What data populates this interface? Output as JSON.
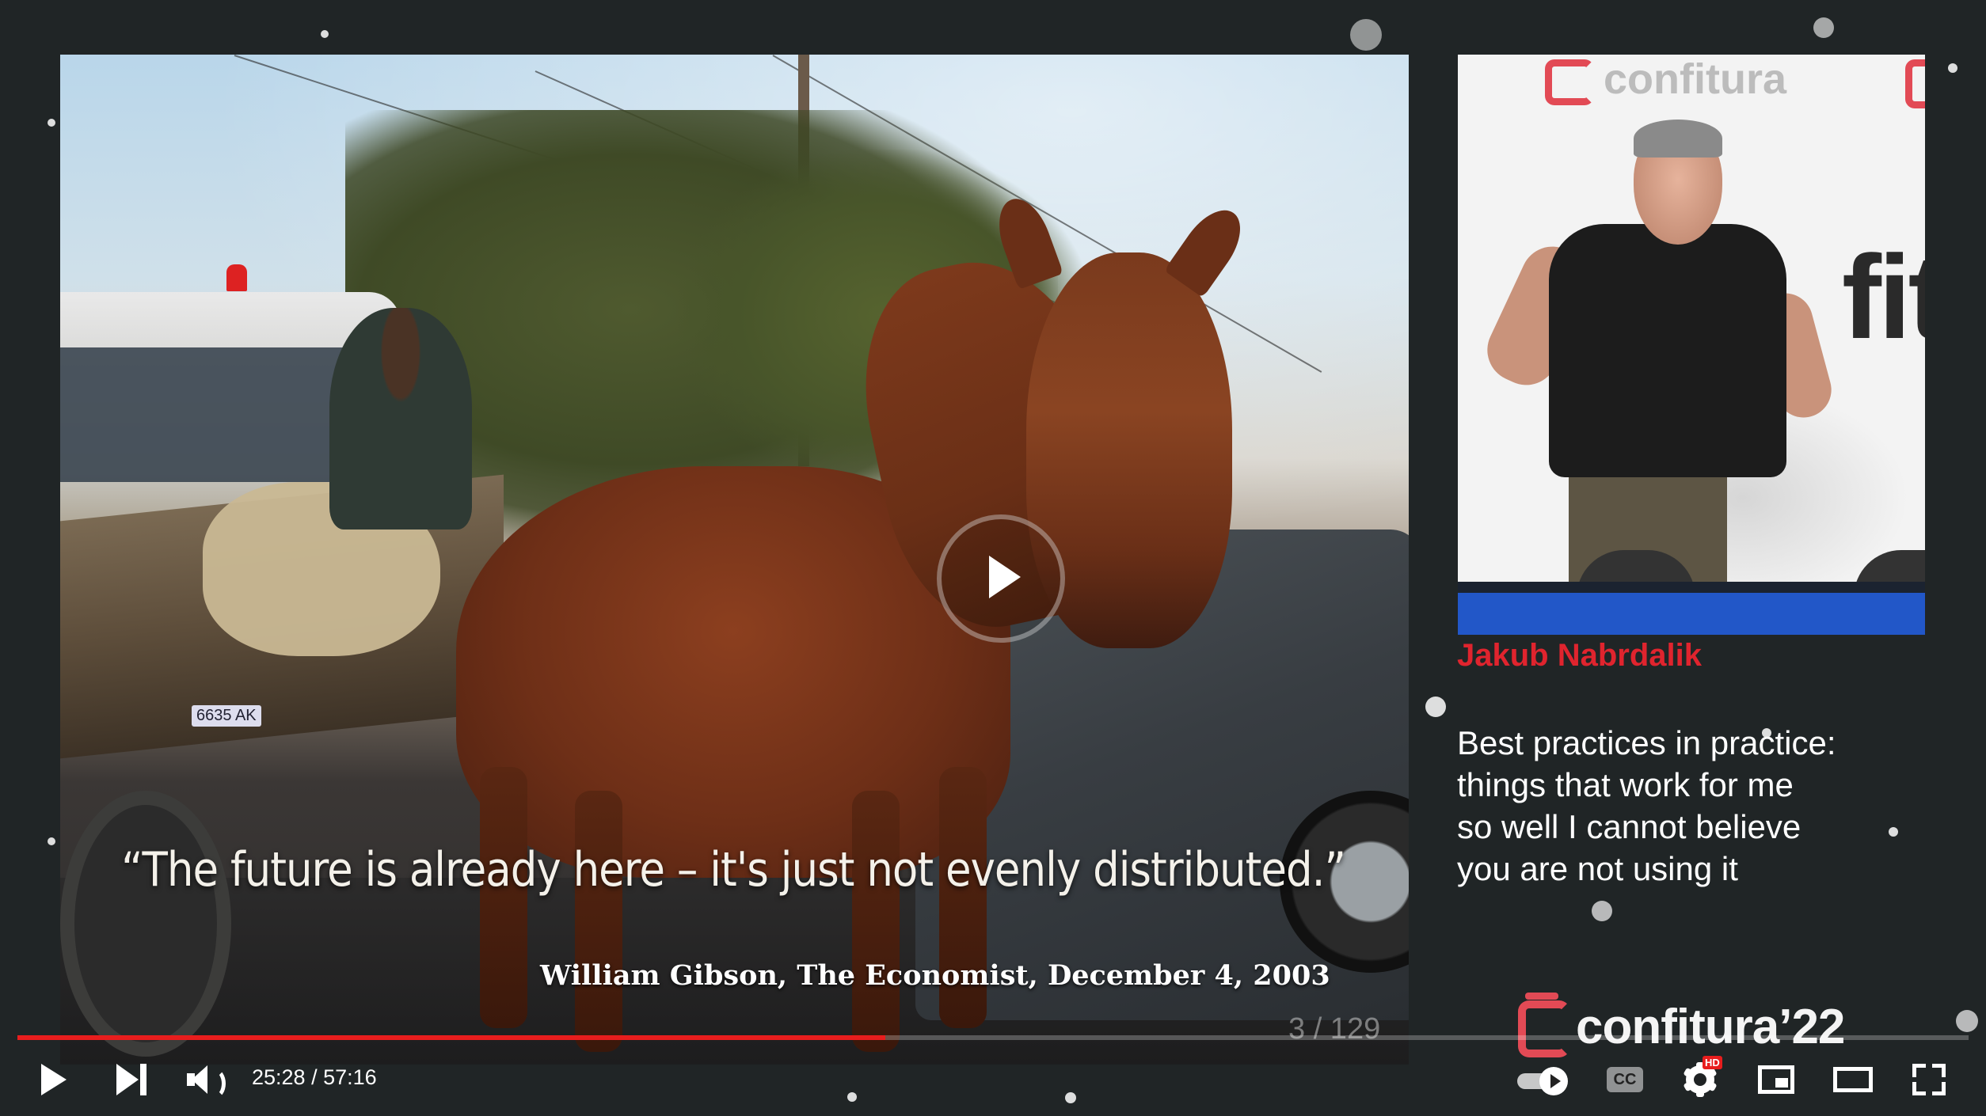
{
  "slide": {
    "quote": "“The future is already here – it's just not evenly distributed.”",
    "attribution": "William Gibson, The Economist, December 4, 2003",
    "counter": "3 / 129",
    "truck_plate": "6635 AK"
  },
  "speaker_panel": {
    "logo_text": "confitura",
    "backdrop_text": "fit"
  },
  "talk": {
    "speaker_name": "Jakub Nabrdalik",
    "title_lines": [
      "Best practices in practice:",
      "things that work for me",
      "so well I cannot believe",
      "you are not using it"
    ]
  },
  "conference_logo": "confitura’22",
  "player": {
    "current_time": "25:28",
    "duration": "57:16",
    "time_display": "25:28 / 57:16",
    "progress_fraction": 0.4448,
    "hd_badge": "HD",
    "cc_label": "CC",
    "icons": {
      "play": "play-icon",
      "next": "next-icon",
      "volume": "volume-icon",
      "autoplay": "autoplay-toggle-icon",
      "captions": "captions-icon",
      "settings": "gear-icon",
      "miniplayer": "miniplayer-icon",
      "theater": "theater-mode-icon",
      "fullscreen": "fullscreen-icon",
      "big_play": "big-play-icon"
    },
    "colors": {
      "progress": "#e81d1d",
      "speaker_name": "#e0242e",
      "brand": "#e24a55"
    }
  }
}
